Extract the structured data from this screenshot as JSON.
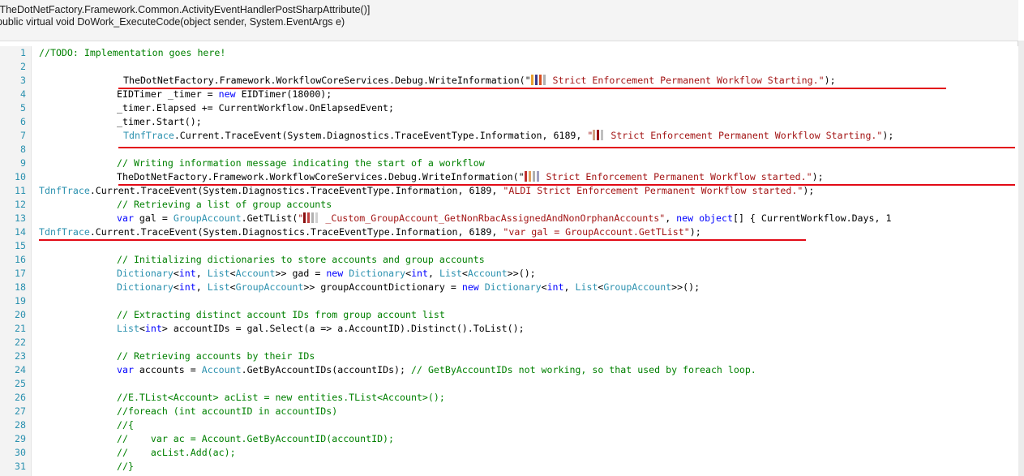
{
  "header": {
    "attribute_line": "[TheDotNetFactory.Framework.Common.ActivityEventHandlerPostSharpAttribute()]",
    "signature_line": "public virtual void DoWork_ExecuteCode(object sender, System.EventArgs e)"
  },
  "lines": [
    {
      "n": "1",
      "indent": 48,
      "segs": [
        {
          "t": "//TODO: Implementation goes here!",
          "c": "cm"
        }
      ]
    },
    {
      "n": "2",
      "indent": 48,
      "segs": []
    },
    {
      "n": "3",
      "indent": 152,
      "segs": [
        {
          "t": "TheDotNetFactory.Framework.WorkflowCoreServices.Debug.WriteInformation(\"",
          "c": ""
        },
        {
          "t": "",
          "c": "blot-a"
        },
        {
          "t": " Strict Enforcement Permanent Workflow Starting.\"",
          "c": "st"
        },
        {
          "t": ");",
          "c": ""
        }
      ]
    },
    {
      "n": "4",
      "indent": 144,
      "segs": [
        {
          "t": "EIDTimer _timer = ",
          "c": ""
        },
        {
          "t": "new",
          "c": "kw"
        },
        {
          "t": " EIDTimer(18000);",
          "c": ""
        }
      ]
    },
    {
      "n": "5",
      "indent": 144,
      "segs": [
        {
          "t": "_timer.Elapsed += CurrentWorkflow.OnElapsedEvent;",
          "c": ""
        }
      ]
    },
    {
      "n": "6",
      "indent": 144,
      "segs": [
        {
          "t": "_timer.Start();",
          "c": ""
        }
      ]
    },
    {
      "n": "7",
      "indent": 152,
      "segs": [
        {
          "t": "TdnfTrace",
          "c": "ty"
        },
        {
          "t": ".Current.TraceEvent(System.Diagnostics.TraceEventType.Information, 6189, ",
          "c": ""
        },
        {
          "t": "\"",
          "c": "st"
        },
        {
          "t": "",
          "c": "blot-b"
        },
        {
          "t": " Strict Enforcement Permanent Workflow Starting.\"",
          "c": "st"
        },
        {
          "t": ");",
          "c": ""
        }
      ]
    },
    {
      "n": "8",
      "indent": 48,
      "segs": []
    },
    {
      "n": "9",
      "indent": 144,
      "segs": [
        {
          "t": "// Writing information message indicating the start of a workflow",
          "c": "cm"
        }
      ]
    },
    {
      "n": "10",
      "indent": 144,
      "segs": [
        {
          "t": "TheDotNetFactory.Framework.WorkflowCoreServices.Debug.WriteInformation(\"",
          "c": ""
        },
        {
          "t": "",
          "c": "blot-c"
        },
        {
          "t": " Strict Enforcement Permanent Workflow started.\"",
          "c": "st"
        },
        {
          "t": ");",
          "c": ""
        }
      ]
    },
    {
      "n": "11",
      "indent": 48,
      "segs": [
        {
          "t": "TdnfTrace",
          "c": "ty"
        },
        {
          "t": ".Current.TraceEvent(System.Diagnostics.TraceEventType.Information, 6189, ",
          "c": ""
        },
        {
          "t": "\"ALDI Strict Enforcement Permanent Workflow started.\"",
          "c": "st"
        },
        {
          "t": ");",
          "c": ""
        }
      ]
    },
    {
      "n": "12",
      "indent": 144,
      "segs": [
        {
          "t": "// Retrieving a list of group accounts",
          "c": "cm"
        }
      ]
    },
    {
      "n": "13",
      "indent": 144,
      "segs": [
        {
          "t": "var",
          "c": "kw"
        },
        {
          "t": " gal = ",
          "c": ""
        },
        {
          "t": "GroupAccount",
          "c": "ty"
        },
        {
          "t": ".GetTList(",
          "c": ""
        },
        {
          "t": "\"",
          "c": "st"
        },
        {
          "t": "",
          "c": "blot-d"
        },
        {
          "t": " _Custom_GroupAccount_GetNonRbacAssignedAndNonOrphanAccounts\"",
          "c": "st"
        },
        {
          "t": ", ",
          "c": ""
        },
        {
          "t": "new",
          "c": "kw"
        },
        {
          "t": " ",
          "c": ""
        },
        {
          "t": "object",
          "c": "kw"
        },
        {
          "t": "[] { CurrentWorkflow.Days, 1",
          "c": ""
        }
      ]
    },
    {
      "n": "14",
      "indent": 48,
      "segs": [
        {
          "t": "TdnfTrace",
          "c": "ty"
        },
        {
          "t": ".Current.TraceEvent(System.Diagnostics.TraceEventType.Information, 6189, ",
          "c": ""
        },
        {
          "t": "\"var gal = GroupAccount.GetTList\"",
          "c": "st"
        },
        {
          "t": ");",
          "c": ""
        }
      ]
    },
    {
      "n": "15",
      "indent": 48,
      "segs": []
    },
    {
      "n": "16",
      "indent": 144,
      "segs": [
        {
          "t": "// Initializing dictionaries to store accounts and group accounts",
          "c": "cm"
        }
      ]
    },
    {
      "n": "17",
      "indent": 144,
      "segs": [
        {
          "t": "Dictionary",
          "c": "ty"
        },
        {
          "t": "<",
          "c": ""
        },
        {
          "t": "int",
          "c": "kw"
        },
        {
          "t": ", ",
          "c": ""
        },
        {
          "t": "List",
          "c": "ty"
        },
        {
          "t": "<",
          "c": ""
        },
        {
          "t": "Account",
          "c": "ty"
        },
        {
          "t": ">> gad = ",
          "c": ""
        },
        {
          "t": "new",
          "c": "kw"
        },
        {
          "t": " ",
          "c": ""
        },
        {
          "t": "Dictionary",
          "c": "ty"
        },
        {
          "t": "<",
          "c": ""
        },
        {
          "t": "int",
          "c": "kw"
        },
        {
          "t": ", ",
          "c": ""
        },
        {
          "t": "List",
          "c": "ty"
        },
        {
          "t": "<",
          "c": ""
        },
        {
          "t": "Account",
          "c": "ty"
        },
        {
          "t": ">>();",
          "c": ""
        }
      ]
    },
    {
      "n": "18",
      "indent": 144,
      "segs": [
        {
          "t": "Dictionary",
          "c": "ty"
        },
        {
          "t": "<",
          "c": ""
        },
        {
          "t": "int",
          "c": "kw"
        },
        {
          "t": ", ",
          "c": ""
        },
        {
          "t": "List",
          "c": "ty"
        },
        {
          "t": "<",
          "c": ""
        },
        {
          "t": "GroupAccount",
          "c": "ty"
        },
        {
          "t": ">> groupAccountDictionary = ",
          "c": ""
        },
        {
          "t": "new",
          "c": "kw"
        },
        {
          "t": " ",
          "c": ""
        },
        {
          "t": "Dictionary",
          "c": "ty"
        },
        {
          "t": "<",
          "c": ""
        },
        {
          "t": "int",
          "c": "kw"
        },
        {
          "t": ", ",
          "c": ""
        },
        {
          "t": "List",
          "c": "ty"
        },
        {
          "t": "<",
          "c": ""
        },
        {
          "t": "GroupAccount",
          "c": "ty"
        },
        {
          "t": ">>();",
          "c": ""
        }
      ]
    },
    {
      "n": "19",
      "indent": 48,
      "segs": []
    },
    {
      "n": "20",
      "indent": 144,
      "segs": [
        {
          "t": "// Extracting distinct account IDs from group account list",
          "c": "cm"
        }
      ]
    },
    {
      "n": "21",
      "indent": 144,
      "segs": [
        {
          "t": "List",
          "c": "ty"
        },
        {
          "t": "<",
          "c": ""
        },
        {
          "t": "int",
          "c": "kw"
        },
        {
          "t": "> accountIDs = gal.Select(a => a.AccountID).Distinct().ToList();",
          "c": ""
        }
      ]
    },
    {
      "n": "22",
      "indent": 48,
      "segs": []
    },
    {
      "n": "23",
      "indent": 144,
      "segs": [
        {
          "t": "// Retrieving accounts by their IDs",
          "c": "cm"
        }
      ]
    },
    {
      "n": "24",
      "indent": 144,
      "segs": [
        {
          "t": "var",
          "c": "kw"
        },
        {
          "t": " accounts = ",
          "c": ""
        },
        {
          "t": "Account",
          "c": "ty"
        },
        {
          "t": ".GetByAccountIDs(accountIDs); ",
          "c": ""
        },
        {
          "t": "// GetByAccountIDs not working, so that used by foreach loop.",
          "c": "cm"
        }
      ]
    },
    {
      "n": "25",
      "indent": 48,
      "segs": []
    },
    {
      "n": "26",
      "indent": 144,
      "segs": [
        {
          "t": "//E.TList<Account> acList = new entities.TList<Account>();",
          "c": "cm"
        }
      ]
    },
    {
      "n": "27",
      "indent": 144,
      "segs": [
        {
          "t": "//foreach (int accountID in accountIDs)",
          "c": "cm"
        }
      ]
    },
    {
      "n": "28",
      "indent": 144,
      "segs": [
        {
          "t": "//{",
          "c": "cm"
        }
      ]
    },
    {
      "n": "29",
      "indent": 144,
      "segs": [
        {
          "t": "//    var ac = Account.GetByAccountID(accountID);",
          "c": "cm"
        }
      ]
    },
    {
      "n": "30",
      "indent": 144,
      "segs": [
        {
          "t": "//    acList.Add(ac);",
          "c": "cm"
        }
      ]
    },
    {
      "n": "31",
      "indent": 144,
      "segs": [
        {
          "t": "//}",
          "c": "cm"
        }
      ]
    }
  ],
  "colors": {
    "keyword": "#0000ff",
    "type": "#2b91af",
    "comment": "#008000",
    "string": "#a31515",
    "underline": "#e20a16",
    "line_number": "#2b91af"
  },
  "annotations": [
    {
      "line": "3",
      "style": "red-underline"
    },
    {
      "line": "7",
      "style": "red-underline"
    },
    {
      "line": "10",
      "style": "red-underline"
    },
    {
      "line": "14",
      "style": "red-underline"
    }
  ]
}
